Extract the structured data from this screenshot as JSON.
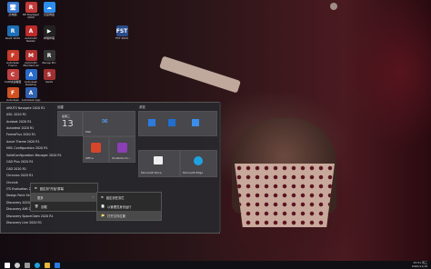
{
  "desktop_icons": [
    {
      "label": "此电脑",
      "color": "#3a7bd5",
      "glyph": "🖥"
    },
    {
      "label": "RP Raylegal 2020",
      "color": "#c03a3a",
      "glyph": "R"
    },
    {
      "label": "百度网盘",
      "color": "#2d8cf0",
      "glyph": "☁"
    },
    {
      "label": "Revit 2020",
      "color": "#1d6fb5",
      "glyph": "R"
    },
    {
      "label": "AutoCAD Raster",
      "color": "#bd2b2b",
      "glyph": "A"
    },
    {
      "label": "哔哩哔哩",
      "color": "#222",
      "glyph": "▶"
    },
    {
      "label": "FST 2020",
      "color": "#2b4c8a",
      "glyph": "FST"
    },
    {
      "label": "Autodesk Fusion",
      "color": "#c83a2a",
      "glyph": "F"
    },
    {
      "label": "AutoCAD Mechanical",
      "color": "#b23030",
      "glyph": "M"
    },
    {
      "label": "Recap Pro",
      "color": "#333",
      "glyph": "R"
    },
    {
      "label": "CAD快速看图",
      "color": "#c04040",
      "glyph": "C"
    },
    {
      "label": "Autodesk Desktop",
      "color": "#2a6ac9",
      "glyph": "A"
    },
    {
      "label": "SAAS",
      "color": "#a03030",
      "glyph": "S"
    },
    {
      "label": "Autodesk App",
      "color": "#3060b0",
      "glyph": "A"
    },
    {
      "label": "Autodesk Fusion 360",
      "color": "#d05020",
      "glyph": "F"
    }
  ],
  "start_menu": {
    "apps": [
      "ARKITS Navigate 2020 R1",
      "ASIL 2020 R1",
      "Acrobat 2020 R1",
      "Autodesk 2020 R1",
      "FormaFlux 2020 R1",
      "Azure Theme 2020 R1",
      "HEIL Configuration 2020 R1",
      "SolidConfiguration Manager 2020 R1",
      "CAD Plus 2020 R1",
      "CAD 2020 R1",
      "Chronico 2020 R1",
      "Chronik",
      "ITS Evaluation 2020 R1",
      "Design Point Service 2020 R1",
      "Discovery 2020 R1",
      "Discovery AIM 2020 R1",
      "Discovery SpaceClaim 2020 R1",
      "Discovery Live 2020 R1"
    ],
    "group1_label": "创建",
    "group2_label": "浏览",
    "tiles": [
      {
        "label": "",
        "day": "13",
        "weekday": "星期三"
      },
      {
        "label": "Mail"
      },
      {
        "label": "Office"
      },
      {
        "label": "OneNote for..."
      },
      {
        "label": "Microsoft Store"
      },
      {
        "label": "Microsoft Edge"
      }
    ]
  },
  "context_menus": {
    "menu1": [
      {
        "icon": "⊞",
        "label": "固定到\"开始\"屏幕"
      },
      {
        "icon": "",
        "label": "更多"
      },
      {
        "icon": "🗑",
        "label": "卸载"
      }
    ],
    "menu2": [
      {
        "icon": "⊞",
        "label": "固定到任务栏"
      },
      {
        "icon": "📄",
        "label": "以管理员身份运行"
      },
      {
        "icon": "📁",
        "label": "打开文件位置"
      }
    ]
  },
  "taskbar": {
    "time": "15:51 周三",
    "date": "2020/11/18"
  }
}
